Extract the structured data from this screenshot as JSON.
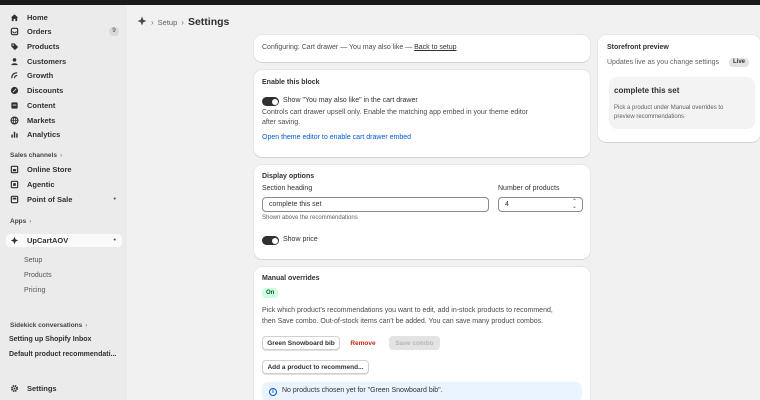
{
  "nav": {
    "items": [
      {
        "label": "Home",
        "icon": "home-icon"
      },
      {
        "label": "Orders",
        "icon": "orders-icon",
        "badge": "9"
      },
      {
        "label": "Products",
        "icon": "tag-icon"
      },
      {
        "label": "Customers",
        "icon": "person-icon"
      },
      {
        "label": "Growth",
        "icon": "growth-icon"
      },
      {
        "label": "Discounts",
        "icon": "discount-icon"
      },
      {
        "label": "Content",
        "icon": "content-icon"
      },
      {
        "label": "Markets",
        "icon": "globe-icon"
      },
      {
        "label": "Analytics",
        "icon": "chart-icon"
      }
    ],
    "sales_channels_label": "Sales channels",
    "channels": [
      {
        "label": "Online Store",
        "icon": "store-icon"
      },
      {
        "label": "Agentic",
        "icon": "agentic-icon"
      },
      {
        "label": "Point of Sale",
        "icon": "pos-icon"
      }
    ],
    "apps_label": "Apps",
    "app": {
      "label": "UpCartAOV",
      "icon": "app-icon"
    },
    "app_subitems": [
      "Setup",
      "Products",
      "Pricing"
    ],
    "sidekick_label": "Sidekick conversations",
    "conversations": [
      "Setting up Shopify Inbox",
      "Default product recommendati..."
    ],
    "settings_label": "Settings"
  },
  "breadcrumb": {
    "parent": "Setup",
    "title": "Settings"
  },
  "config_card": {
    "prefix": "Configuring: Cart drawer — You may also like — ",
    "link": "Back to setup"
  },
  "enable_card": {
    "title": "Enable this block",
    "toggle_label": "Show \"You may also like\" in the cart drawer",
    "desc_line1": "Controls cart drawer upsell only. Enable the matching app embed in your theme editor",
    "desc_line2": "after saving.",
    "link": "Open theme editor to enable cart drawer embed"
  },
  "display_card": {
    "title": "Display options",
    "heading_label": "Section heading",
    "heading_value": "complete this set",
    "heading_help": "Shown above the recommendations",
    "number_label": "Number of products",
    "number_value": "4",
    "price_label": "Show price"
  },
  "overrides_card": {
    "title": "Manual overrides",
    "badge": "On",
    "desc_line1": "Pick which product's recommendations you want to edit, add in-stock products to recommend,",
    "desc_line2": "then Save combo. Out-of-stock items can't be added. You can save many product combos.",
    "product_button": "Green Snowboard bib",
    "remove_button": "Remove",
    "save_button": "Save combo",
    "add_button": "Add a product to recommend...",
    "banner_text": "No products chosen yet for \"Green Snowboard bib\"."
  },
  "preview": {
    "title": "Storefront preview",
    "subtitle": "Updates live as you change settings",
    "live_badge": "Live",
    "heading": "complete this set",
    "hint_line1": "Pick a product under Manual overrides to",
    "hint_line2": "preview recommendations"
  }
}
